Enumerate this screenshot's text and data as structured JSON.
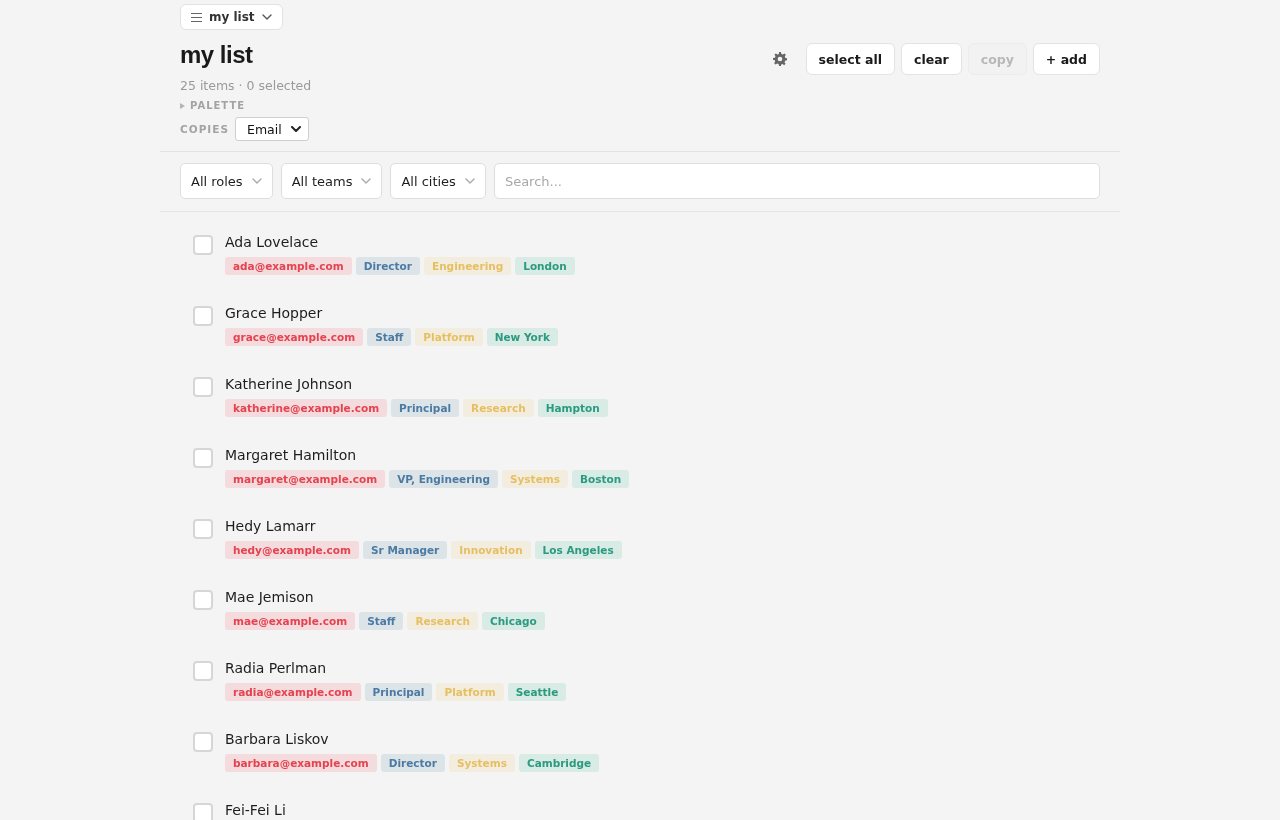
{
  "list_switcher": {
    "label": "my list"
  },
  "header": {
    "title": "my list",
    "summary": "25 items · 0 selected",
    "palette": {
      "label": "PALETTE",
      "expanded": false
    },
    "copies": {
      "label": "COPIES",
      "value": "Email"
    }
  },
  "actions": [
    {
      "label": "select all",
      "disabled": false
    },
    {
      "label": "clear",
      "disabled": false
    },
    {
      "label": "copy",
      "disabled": true
    },
    {
      "label": "+ add",
      "disabled": false
    }
  ],
  "filters": [
    {
      "label": "All roles"
    },
    {
      "label": "All teams"
    },
    {
      "label": "All cities"
    }
  ],
  "search": {
    "placeholder": "Search..."
  },
  "rows": [
    {
      "name": "Ada Lovelace",
      "checked": false,
      "email": "ada@example.com",
      "role": "Director",
      "team": "Engineering",
      "city": "London"
    },
    {
      "name": "Grace Hopper",
      "checked": false,
      "email": "grace@example.com",
      "role": "Staff",
      "team": "Platform",
      "city": "New York"
    },
    {
      "name": "Katherine Johnson",
      "checked": false,
      "email": "katherine@example.com",
      "role": "Principal",
      "team": "Research",
      "city": "Hampton"
    },
    {
      "name": "Margaret Hamilton",
      "checked": false,
      "email": "margaret@example.com",
      "role": "VP, Engineering",
      "team": "Systems",
      "city": "Boston"
    },
    {
      "name": "Hedy Lamarr",
      "checked": false,
      "email": "hedy@example.com",
      "role": "Sr Manager",
      "team": "Innovation",
      "city": "Los Angeles"
    },
    {
      "name": "Mae Jemison",
      "checked": false,
      "email": "mae@example.com",
      "role": "Staff",
      "team": "Research",
      "city": "Chicago"
    },
    {
      "name": "Radia Perlman",
      "checked": false,
      "email": "radia@example.com",
      "role": "Principal",
      "team": "Platform",
      "city": "Seattle"
    },
    {
      "name": "Barbara Liskov",
      "checked": false,
      "email": "barbara@example.com",
      "role": "Director",
      "team": "Systems",
      "city": "Cambridge"
    },
    {
      "name": "Fei-Fei Li",
      "checked": false
    }
  ]
}
